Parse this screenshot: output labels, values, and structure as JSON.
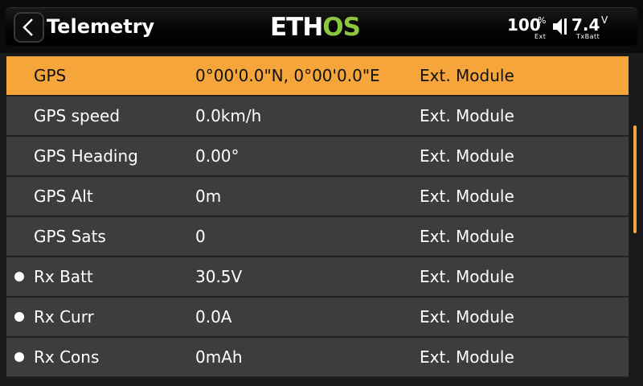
{
  "header": {
    "title": "Telemetry",
    "logo": "ETHOS",
    "ext_battery": "100",
    "ext_battery_unit": "%",
    "ext_label": "Ext",
    "tx_voltage": "7.4",
    "tx_voltage_unit": "V",
    "tx_label": "TxBatt",
    "back_icon": "chevron-left-icon",
    "speaker_icon": "speaker-icon"
  },
  "colors": {
    "accent": "#f6a53a",
    "logo_green": "#8cc63f",
    "row_bg": "#3d3d3d"
  },
  "sensors": [
    {
      "name": "GPS",
      "value": "0°00'0.0\"N, 0°00'0.0\"E",
      "source": "Ext. Module",
      "dot": false,
      "selected": true
    },
    {
      "name": "GPS speed",
      "value": "0.0km/h",
      "source": "Ext. Module",
      "dot": false
    },
    {
      "name": "GPS Heading",
      "value": "0.00°",
      "source": "Ext. Module",
      "dot": false
    },
    {
      "name": "GPS Alt",
      "value": "0m",
      "source": "Ext. Module",
      "dot": false
    },
    {
      "name": "GPS Sats",
      "value": "0",
      "source": "Ext. Module",
      "dot": false
    },
    {
      "name": "Rx Batt",
      "value": "30.5V",
      "source": "Ext. Module",
      "dot": true
    },
    {
      "name": "Rx Curr",
      "value": "0.0A",
      "source": "Ext. Module",
      "dot": true
    },
    {
      "name": "Rx Cons",
      "value": "0mAh",
      "source": "Ext. Module",
      "dot": true
    }
  ]
}
